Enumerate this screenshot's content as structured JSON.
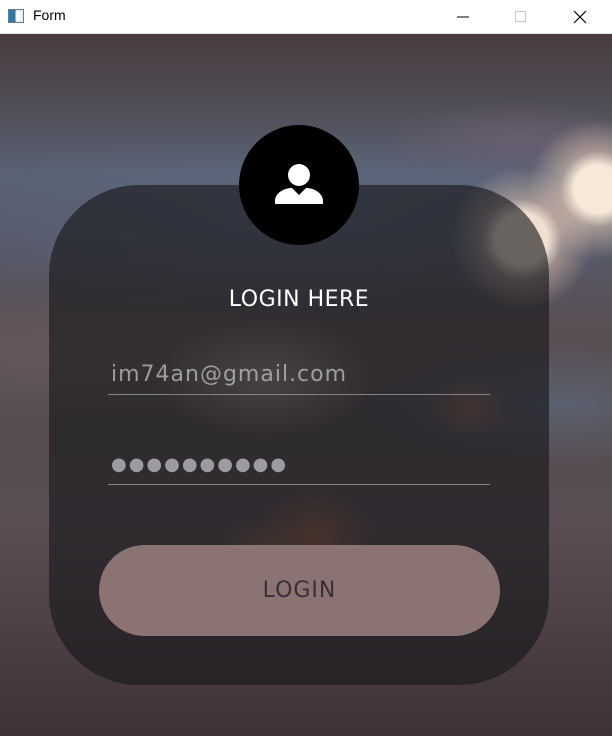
{
  "window": {
    "title": "Form",
    "icon": "app-window-icon",
    "controls": [
      "minimize-icon",
      "maximize-icon",
      "close-icon"
    ]
  },
  "form": {
    "avatar_icon": "user-icon",
    "heading": "LOGIN HERE",
    "email": {
      "value": "im74an@gmail.com"
    },
    "password": {
      "value": "●●●●●●●●●●"
    },
    "login_label": "LOGIN"
  },
  "colors": {
    "card": "#16161a",
    "button": "#8b7373",
    "button_text": "#3a2f33",
    "heading": "#ffffff"
  }
}
